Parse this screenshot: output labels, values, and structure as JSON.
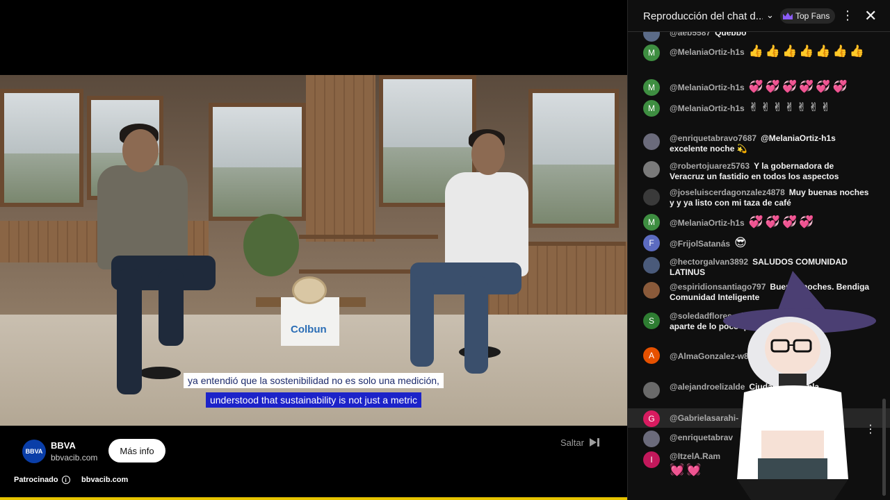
{
  "video": {
    "subtitle_es": "ya entendió que la sostenibilidad no es solo una medición,",
    "subtitle_en": "understood that sustainability is not just a metric",
    "scene_logo_text": "Colbun"
  },
  "ad": {
    "logo_text": "BBVA",
    "advertiser": "BBVA",
    "domain": "bbvacib.com",
    "more_button": "Más info",
    "skip_label": "Saltar",
    "sponsored_label": "Patrocinado",
    "sponsored_domain": "bbvacib.com",
    "progress_color": "#e6c300"
  },
  "chat": {
    "title": "Reproducción del chat d...",
    "top_fans_label": "Top Fans",
    "messages": [
      {
        "author": "@aeb5587",
        "text": "Quebbo",
        "avatar_letter": "",
        "avatar_color": "#5b6b88"
      },
      {
        "author": "@MelaniaOrtiz-h1s",
        "text": "👍👍👍👍👍👍👍",
        "avatar_letter": "M",
        "avatar_color": "#3e8e41"
      },
      {
        "author": "@MelaniaOrtiz-h1s",
        "text": "💞💞💞💞💞💞",
        "avatar_letter": "M",
        "avatar_color": "#3e8e41"
      },
      {
        "author": "@MelaniaOrtiz-h1s",
        "text": "✌✌✌✌✌✌✌",
        "avatar_letter": "M",
        "avatar_color": "#3e8e41"
      },
      {
        "author": "@enriquetabravo7687",
        "text": "@MelaniaOrtiz-h1s excelente noche 💫",
        "avatar_letter": "",
        "avatar_color": "#6b6b7b"
      },
      {
        "author": "@robertojuarez5763",
        "text": "Y la gobernadora de Veracruz un fastidio en todos los aspectos",
        "avatar_letter": "",
        "avatar_color": "#7a7a7a"
      },
      {
        "author": "@joseluiscerdagonzalez4878",
        "text": "Muy buenas noches y y ya listo con mi taza de café",
        "avatar_letter": "",
        "avatar_color": "#3a3a3a"
      },
      {
        "author": "@MelaniaOrtiz-h1s",
        "text": "💞💞💞💞",
        "avatar_letter": "M",
        "avatar_color": "#3e8e41"
      },
      {
        "author": "@FrijolSatanás",
        "text": "😎",
        "avatar_letter": "F",
        "avatar_color": "#5c6bc0"
      },
      {
        "author": "@hectorgalvan3892",
        "text": "SALUDOS COMUNIDAD LATINUS",
        "avatar_letter": "",
        "avatar_color": "#4a5a7a"
      },
      {
        "author": "@espiridionsantiago797",
        "text": "Buenas noches. Bendiga Comunidad Inteligente",
        "avatar_letter": "",
        "avatar_color": "#8a5a3a"
      },
      {
        "author": "@soledadflores",
        "text": "piso , extorsión y asesinatos ... aparte de lo poco que aparece en",
        "avatar_letter": "S",
        "avatar_color": "#2e7d32"
      },
      {
        "author": "@AlmaGonzalez-w8y",
        "text": "🌹🙏 🤗",
        "avatar_letter": "A",
        "avatar_color": "#e65100"
      },
      {
        "author": "@alejandroelizalde",
        "text": "Ciudad de Puebla",
        "avatar_letter": "",
        "avatar_color": "#6a6a6a"
      },
      {
        "author": "@Gabrielasarahi-",
        "text": "",
        "avatar_letter": "G",
        "avatar_color": "#d81b60"
      },
      {
        "author": "@enriquetabrav",
        "text": "",
        "avatar_letter": "",
        "avatar_color": "#6b6b7b"
      },
      {
        "author": "@ItzelA.Ram",
        "text": "💓💓",
        "avatar_letter": "I",
        "avatar_color": "#c2185b"
      }
    ]
  }
}
